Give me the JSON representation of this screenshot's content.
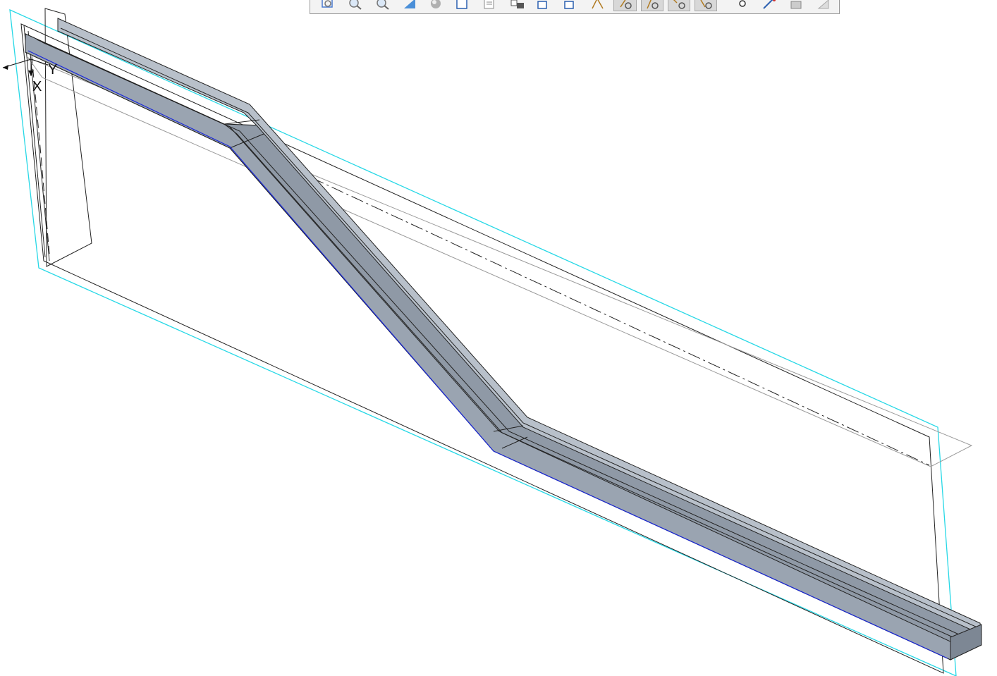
{
  "toolbar": {
    "tools": [
      {
        "name": "refit-icon",
        "active": false
      },
      {
        "name": "zoom-in-icon",
        "active": false
      },
      {
        "name": "zoom-out-icon",
        "active": false
      },
      {
        "name": "view-orient-icon",
        "active": false
      },
      {
        "name": "shading-icon",
        "active": false
      },
      {
        "name": "saved-views-icon",
        "active": false
      },
      {
        "name": "display-style-icon",
        "active": false
      },
      {
        "name": "view-manager-icon",
        "active": false
      },
      {
        "name": "plane-display-icon",
        "active": false
      },
      {
        "name": "axis-display-icon",
        "active": false
      },
      {
        "name": "point-display-icon",
        "active": false
      },
      {
        "name": "csys-display-icon",
        "active": true
      },
      {
        "name": "annotation-display-icon",
        "active": true
      },
      {
        "name": "spin-center-icon",
        "active": true
      },
      {
        "name": "datum-tags-icon",
        "active": true
      },
      {
        "name": "point-tag-icon",
        "active": false
      },
      {
        "name": "curve-tag-icon",
        "active": false
      },
      {
        "name": "sketch-icon",
        "active": false
      },
      {
        "name": "more-icon",
        "active": false
      }
    ]
  },
  "csys": {
    "x_label": "X",
    "y_label": "Y"
  },
  "colors": {
    "part_face": "#99a3b0",
    "part_edge": "#222222",
    "datum_plane": "#27d8e6",
    "silhouette": "#1a28d8"
  }
}
